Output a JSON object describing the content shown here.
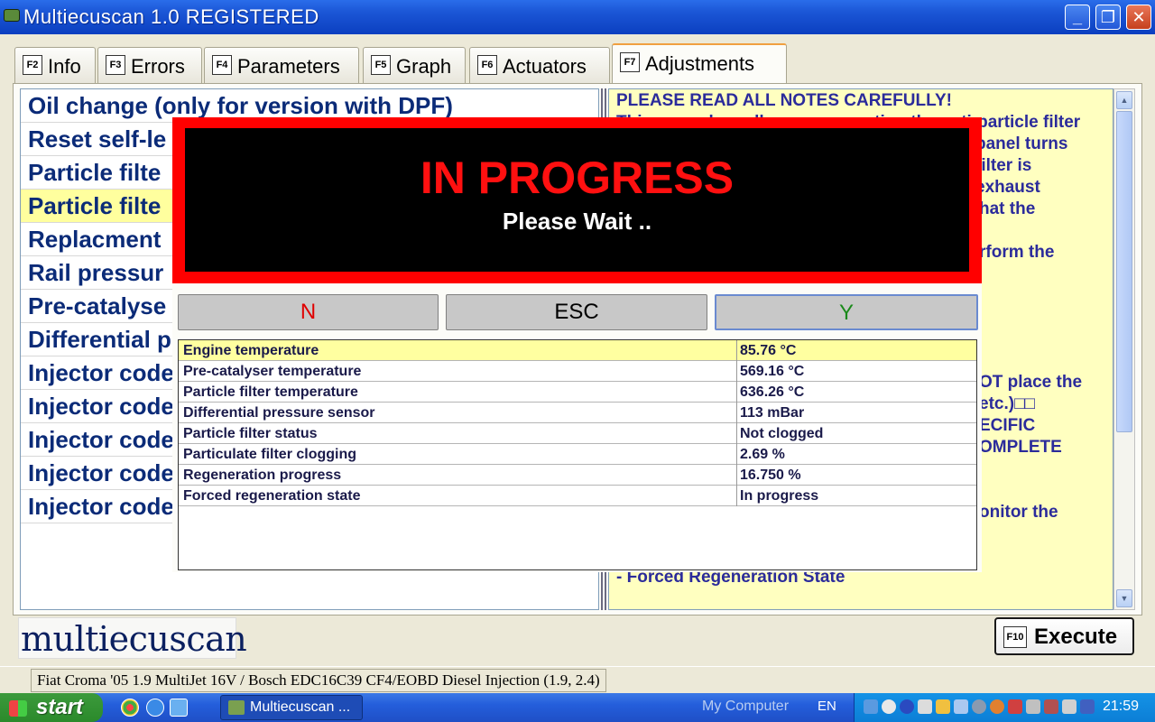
{
  "window": {
    "title": "Multiecuscan 1.0 REGISTERED",
    "minimize": "_",
    "maximize": "❐",
    "close": "✕"
  },
  "tabs": [
    {
      "key": "F2",
      "label": "Info"
    },
    {
      "key": "F3",
      "label": "Errors"
    },
    {
      "key": "F4",
      "label": "Parameters"
    },
    {
      "key": "F5",
      "label": "Graph"
    },
    {
      "key": "F6",
      "label": "Actuators"
    },
    {
      "key": "F7",
      "label": "Adjustments"
    }
  ],
  "procedures": [
    "Oil change (only for version with DPF)",
    "Reset self-le",
    "Particle filte",
    "Particle filte",
    "Replacment",
    "Rail pressur",
    "Pre-catalyse",
    "Differential p",
    "Injector code",
    "Injector code",
    "Injector code",
    "Injector code",
    "Injector code"
  ],
  "notes": {
    "header": "PLEASE READ ALL NOTES CAREFULLY!",
    "fragments": [
      "This procedure allows regeneration the anti-particle filter",
      "panel turns",
      "filter is",
      "exhaust",
      "hat the",
      "rform the",
      "OT place the",
      "etc.)□□",
      "ECIFIC",
      "OMPLETE",
      "onitor the",
      "- Forced Regeneration State"
    ]
  },
  "progress": {
    "title": "IN PROGRESS",
    "subtitle": "Please Wait .."
  },
  "buttons": {
    "no": "N",
    "esc": "ESC",
    "yes": "Y"
  },
  "parameters": [
    {
      "name": "Engine temperature",
      "value": "85.76 °C"
    },
    {
      "name": "Pre-catalyser temperature",
      "value": "569.16 °C"
    },
    {
      "name": "Particle filter temperature",
      "value": "636.26 °C"
    },
    {
      "name": "Differential pressure sensor",
      "value": "113 mBar"
    },
    {
      "name": "Particle filter status",
      "value": "Not clogged"
    },
    {
      "name": "Particulate filter clogging",
      "value": "2.69 %"
    },
    {
      "name": "Regeneration progress",
      "value": "16.750 %"
    },
    {
      "name": "Forced regeneration state",
      "value": "In progress"
    }
  ],
  "logo": "multiecuscan",
  "execute": {
    "key": "F10",
    "label": "Execute"
  },
  "status": "Fiat Croma '05 1.9 MultiJet 16V / Bosch EDC16C39 CF4/EOBD Diesel Injection (1.9, 2.4)",
  "taskbar": {
    "start": "start",
    "task": "Multiecuscan ...",
    "my_computer": "My Computer",
    "lang": "EN",
    "clock": "21:59"
  },
  "colors": {
    "title_bar": "#0b3fc0",
    "progress_red": "#ff0000",
    "no_red": "#e00000",
    "yes_green": "#1a8a1a",
    "list_text": "#0b2b78"
  }
}
